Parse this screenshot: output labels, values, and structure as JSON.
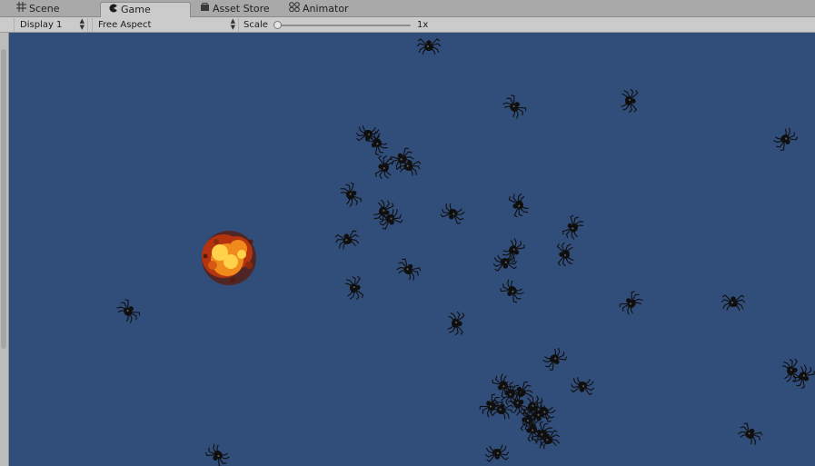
{
  "tabs": [
    {
      "label": "Scene",
      "icon": "grid-icon",
      "active": false
    },
    {
      "label": "Game",
      "icon": "game-controller-icon",
      "active": true
    },
    {
      "label": "Asset Store",
      "icon": "store-bag-icon",
      "active": false
    },
    {
      "label": "Animator",
      "icon": "animator-nodes-icon",
      "active": false
    }
  ],
  "toolbar": {
    "display_label": "Display 1",
    "aspect_label": "Free Aspect",
    "scale_label": "Scale",
    "scale_value": "1x",
    "scale_slider_fraction": 0
  },
  "game_view": {
    "background_color": "#314d79",
    "spider_color": "#0f0f0f",
    "explosion_colors": [
      "#ffd24a",
      "#f08a1c",
      "#b3340e",
      "#5a1a0a"
    ],
    "sprites": {
      "spider_count": 46,
      "explosion_count": 1
    }
  }
}
